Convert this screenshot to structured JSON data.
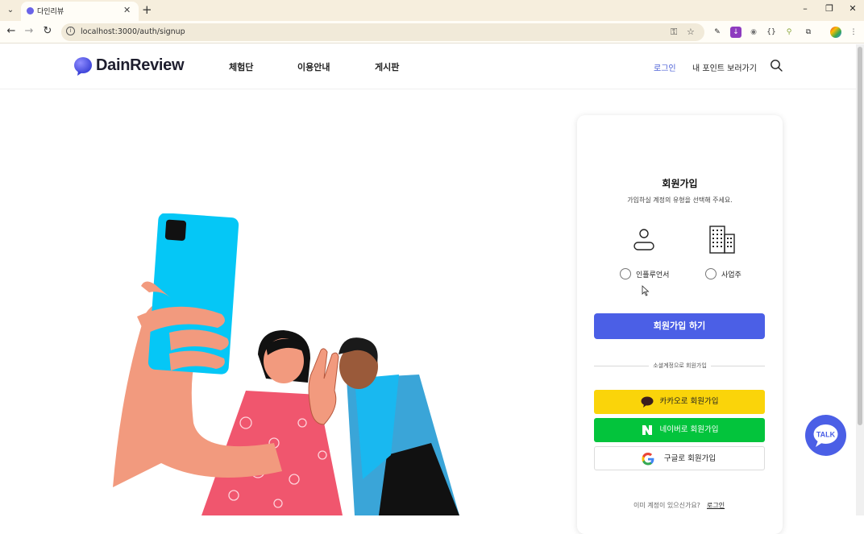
{
  "browser": {
    "tab_title": "다인리뷰",
    "url": "localhost:3000/auth/signup",
    "tab_close": "✕",
    "new_tab": "+",
    "window_controls": [
      "–",
      "❐",
      "✕"
    ]
  },
  "header": {
    "logo_text": "DainReview",
    "nav": [
      "체험단",
      "이용안내",
      "게시판"
    ],
    "login": "로그인",
    "points": "내 포인트 보러가기"
  },
  "signup": {
    "title": "회원가입",
    "subtitle": "가입하실 계정의 유형을 선택해 주세요.",
    "types": [
      {
        "label": "인플루언서",
        "icon": "person-icon"
      },
      {
        "label": "사업주",
        "icon": "building-icon"
      }
    ],
    "submit_label": "회원가입 하기",
    "divider": "소셜계정으로 회원가입",
    "kakao_label": "카카오로 회원가입",
    "naver_label": "네이버로 회원가입",
    "google_label": "구글로 회원가입",
    "have_account": "이미 계정이 있으신가요?",
    "login_link": "로그인"
  },
  "chat": {
    "label": "TALK"
  },
  "colors": {
    "accent": "#4b5fe6",
    "kakao": "#fad40a",
    "naver": "#03c43c",
    "browser_frame": "#f6eedd"
  }
}
